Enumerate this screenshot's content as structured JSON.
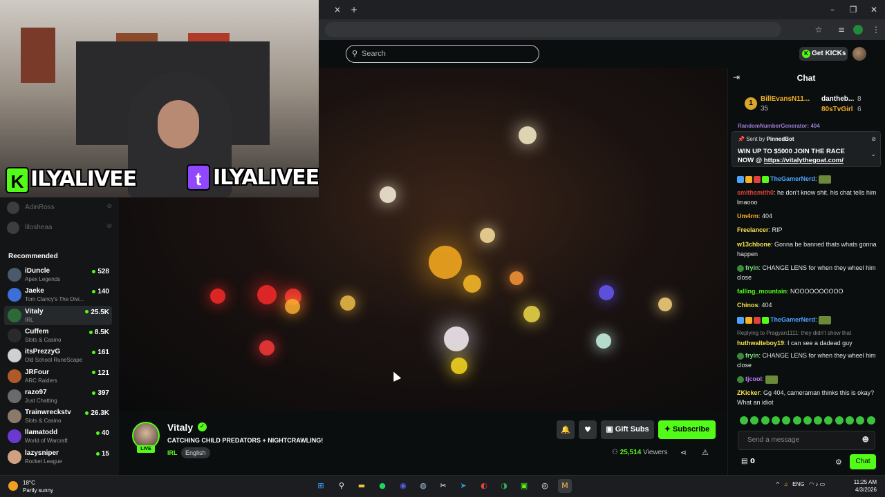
{
  "browser": {
    "tab_close": "×",
    "new_tab": "+",
    "minimize": "–",
    "restore": "❐",
    "close": "✕",
    "star_icon": "☆",
    "menu_icon": "⋮"
  },
  "header": {
    "search_placeholder": "Search",
    "get_kicks_label": "Get KICKs"
  },
  "webcam": {
    "left_label": "ILYALIVEE",
    "right_label": "ILYALIVEE",
    "left_logo": "K",
    "right_logo": "t"
  },
  "sidebar": {
    "offline": [
      {
        "name": "AdinRoss"
      },
      {
        "name": "lilosheaa"
      }
    ],
    "recommended_title": "Recommended",
    "recommended": [
      {
        "name": "iDuncle",
        "category": "Apex Legends",
        "viewers": "528",
        "color": "#4a5a6a"
      },
      {
        "name": "Jaeke",
        "category": "Tom Clancy's The Divi...",
        "viewers": "140",
        "color": "#3d6fd8"
      },
      {
        "name": "Vitaly",
        "category": "IRL",
        "viewers": "25.5K",
        "color": "#2d6a3a"
      },
      {
        "name": "Cuffem",
        "category": "Slots & Casino",
        "viewers": "8.5K",
        "color": "#2a2a2a"
      },
      {
        "name": "itsPrezzyG",
        "category": "Old School RuneScape",
        "viewers": "161",
        "color": "#d0d0d0"
      },
      {
        "name": "JRFour",
        "category": "ARC Raiders",
        "viewers": "121",
        "color": "#b05a2a"
      },
      {
        "name": "razo97",
        "category": "Just Chatting",
        "viewers": "397",
        "color": "#6a6a6a"
      },
      {
        "name": "Trainwreckstv",
        "category": "Slots & Casino",
        "viewers": "26.3K",
        "color": "#8a7a6a"
      },
      {
        "name": "llamatodd",
        "category": "World of Warcraft",
        "viewers": "40",
        "color": "#6a3ad0"
      },
      {
        "name": "lazysniper",
        "category": "Rocket League",
        "viewers": "15",
        "color": "#d0a080"
      }
    ]
  },
  "stream": {
    "streamer": "Vitaly",
    "live": "LIVE",
    "title": "CATCHING CHILD PREDATORS + NIGHTCRAWLING!",
    "category": "IRL",
    "language": "English",
    "viewers": "25,514",
    "viewers_label": "Viewers",
    "gift_subs": "Gift Subs",
    "subscribe": "Subscribe",
    "bell_icon": "🔔",
    "heart_icon": "♥",
    "share_icon": "⋖",
    "report_icon": "⚠"
  },
  "chat": {
    "title": "Chat",
    "collapse_icon": "⇥",
    "leaderboard": {
      "first": {
        "rank": "1",
        "name": "BillEvansN11...",
        "count": "35"
      },
      "second": {
        "name": "dantheb...",
        "count": "8"
      },
      "third": {
        "name": "80sTvGirl",
        "count": "6"
      }
    },
    "cut_row": "RandomNumberGenerator: 404",
    "pinned": {
      "sent_by_label": "Sent by",
      "sender": "PinnedBot",
      "text": "WIN UP TO $5000 JOIN THE RACE NOW @ ",
      "link": "https://vitalythegoat.com/"
    },
    "messages": [
      {
        "user": "TheGamerNerd",
        "text": "",
        "color": "#4ea3ff"
      },
      {
        "user": "smithsmith0",
        "text": "he don't know shit. his chat tells him lmaooo",
        "color": "#e0413a"
      },
      {
        "user": "Um4rm",
        "text": "404",
        "color": "#f5b025"
      },
      {
        "user": "Freelancer",
        "text": "RIP",
        "color": "#f5e04a"
      },
      {
        "user": "w13chbone",
        "text": "Gonna be banned thats whats gonna happen",
        "color": "#f5e04a"
      },
      {
        "user": "fryin",
        "text": "CHANGE LENS for when they wheel him close",
        "color": "#7ee07e"
      },
      {
        "user": "falling_mountain",
        "text": "NOOOOOOOOOO",
        "color": "#53fc18"
      },
      {
        "user": "Chinos",
        "text": "404",
        "color": "#f5e04a"
      },
      {
        "user": "TheGamerNerd",
        "text": "",
        "color": "#4ea3ff"
      },
      {
        "user": "huthwalteboy19",
        "text": "I can see a dadead guy",
        "color": "#f5e04a",
        "reply": "Replying to Pragyan1111: they didn't show that"
      },
      {
        "user": "fryin",
        "text": "CHANGE LENS for when they wheel him close",
        "color": "#7ee07e"
      },
      {
        "user": "tjcool",
        "text": "",
        "color": "#c27bff"
      },
      {
        "user": "ZKicker",
        "text": "Gg 404, cameraman thinks this is okay? What an idiot",
        "color": "#f5e04a"
      }
    ],
    "input_placeholder": "Send a message",
    "emoji_icon": "☻",
    "points": "0",
    "gear_icon": "⚙",
    "send_label": "Chat"
  },
  "taskbar": {
    "temp": "18°C",
    "weather": "Partly sunny",
    "lang": "ENG",
    "time": "11:25 AM",
    "date": "4/3/2026"
  },
  "colors": {
    "accent": "#53fc18",
    "background": "#0b0e0f"
  }
}
